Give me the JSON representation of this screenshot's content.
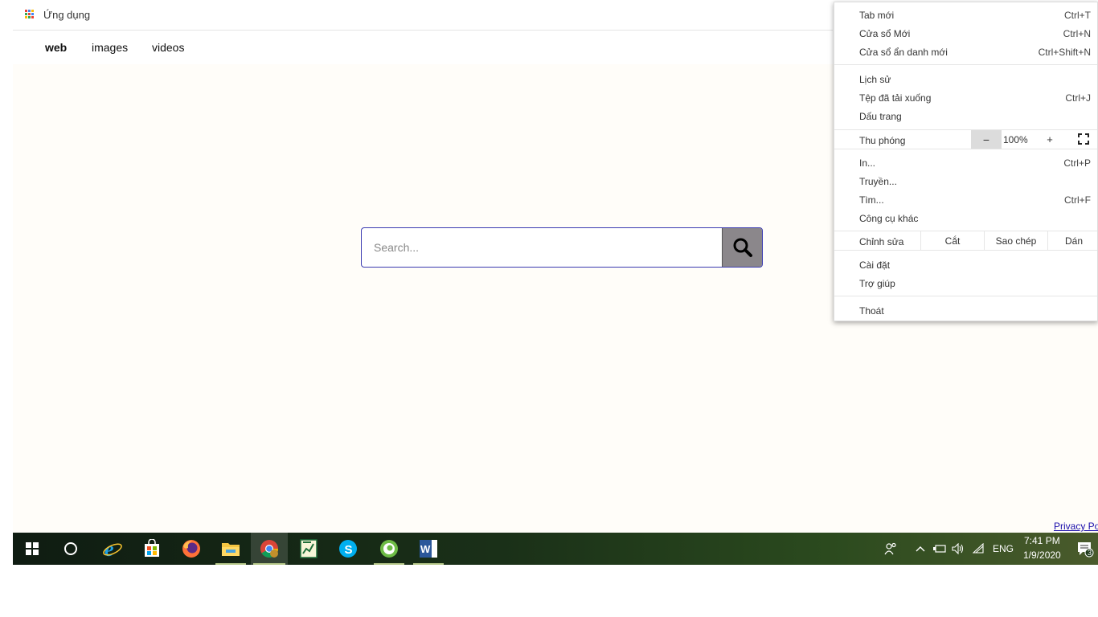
{
  "bookmarks_bar": {
    "apps_label": "Ứng dụng",
    "apps_icon": "apps-grid-icon"
  },
  "nav_tabs": [
    {
      "label": "web",
      "active": true
    },
    {
      "label": "images",
      "active": false
    },
    {
      "label": "videos",
      "active": false
    }
  ],
  "search": {
    "placeholder": "Search...",
    "value": "",
    "button_icon": "search-icon"
  },
  "footer": {
    "privacy_link": "Privacy Po"
  },
  "context_menu": {
    "new_tab": {
      "label": "Tab mới",
      "shortcut": "Ctrl+T"
    },
    "new_window": {
      "label": "Cửa sổ Mới",
      "shortcut": "Ctrl+N"
    },
    "incognito": {
      "label": "Cửa sổ ẩn danh mới",
      "shortcut": "Ctrl+Shift+N"
    },
    "history": {
      "label": "Lịch sử"
    },
    "downloads": {
      "label": "Tệp đã tải xuống",
      "shortcut": "Ctrl+J"
    },
    "bookmarks": {
      "label": "Dấu trang"
    },
    "zoom": {
      "label": "Thu phóng",
      "minus": "−",
      "value": "100%",
      "plus": "+",
      "fullscreen_icon": "fullscreen-icon"
    },
    "print": {
      "label": "In...",
      "shortcut": "Ctrl+P"
    },
    "cast": {
      "label": "Truyền..."
    },
    "find": {
      "label": "Tìm...",
      "shortcut": "Ctrl+F"
    },
    "more_tools": {
      "label": "Công cụ khác"
    },
    "edit": {
      "label": "Chỉnh sửa",
      "cut": "Cắt",
      "copy": "Sao chép",
      "paste": "Dán"
    },
    "settings": {
      "label": "Cài đặt"
    },
    "help": {
      "label": "Trợ giúp"
    },
    "exit": {
      "label": "Thoát"
    }
  },
  "taskbar": {
    "apps": [
      "start-icon",
      "cortana-icon",
      "internet-explorer-icon",
      "store-icon",
      "firefox-icon",
      "file-explorer-icon",
      "chrome-icon",
      "excel-icon",
      "skype-icon",
      "coccoc-icon",
      "word-icon"
    ],
    "tray": {
      "language": "ENG",
      "time": "7:41 PM",
      "date": "1/9/2020",
      "notification_count": "3"
    }
  },
  "colors": {
    "search_border": "#3a3ab0",
    "search_button": "#8b878b",
    "page_background": "#fffdf9",
    "link": "#1a0dab"
  }
}
